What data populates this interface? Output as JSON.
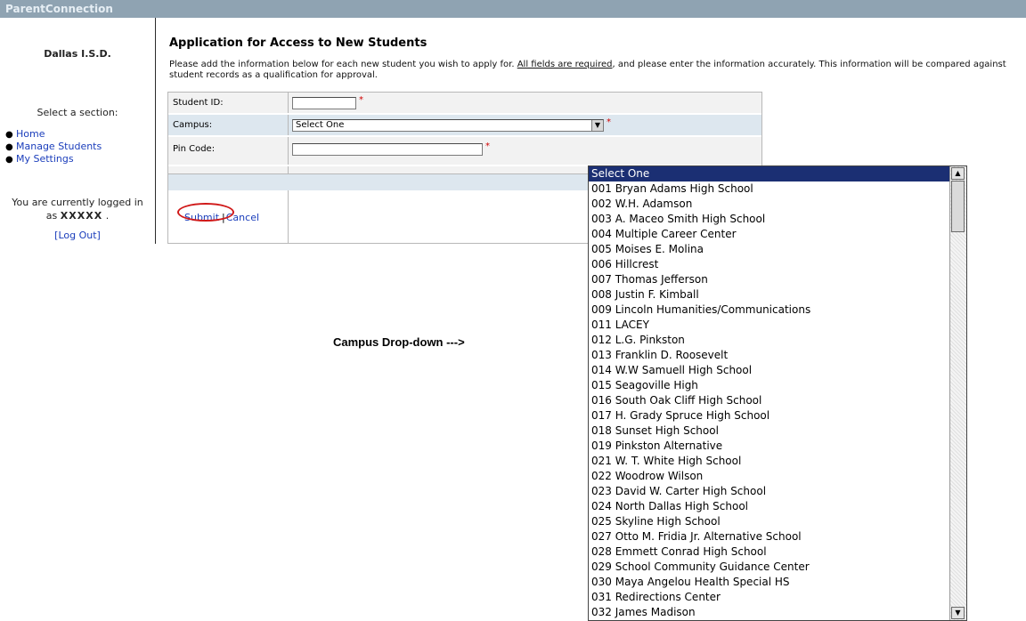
{
  "app": {
    "title": "ParentConnection"
  },
  "sidebar": {
    "district": "Dallas I.S.D.",
    "select_section": "Select a section:",
    "nav": [
      {
        "label": "Home"
      },
      {
        "label": "Manage Students"
      },
      {
        "label": "My Settings"
      }
    ],
    "logged_in_prefix": "You are currently logged in",
    "logged_in_as": "as",
    "username": "XXXXX",
    "logged_in_suffix": ".",
    "logout_label": "[Log Out]"
  },
  "main": {
    "title": "Application for Access to New Students",
    "intro_before": "Please add the information below for each new student you wish to apply for.",
    "intro_required": "All fields are required",
    "intro_after": ", and please enter the information accurately.  This information will be compared against student records as a qualification for approval.",
    "fields": {
      "student_id_label": "Student ID:",
      "campus_label": "Campus:",
      "campus_value": "Select One",
      "pin_label": "Pin Code:",
      "required_mark": "*"
    },
    "submit_label": "Submit",
    "separator": "|",
    "cancel_label": "Cancel"
  },
  "annotation": "Campus Drop-down --->",
  "campus_dropdown": {
    "options": [
      "Select One",
      "001 Bryan Adams High School",
      "002 W.H. Adamson",
      "003 A. Maceo Smith High School",
      "004 Multiple Career Center",
      "005 Moises E. Molina",
      "006 Hillcrest",
      "007 Thomas Jefferson",
      "008 Justin F. Kimball",
      "009 Lincoln Humanities/Communications",
      "011 LACEY",
      "012 L.G. Pinkston",
      "013 Franklin D. Roosevelt",
      "014 W.W Samuell High School",
      "015 Seagoville High",
      "016 South Oak Cliff High School",
      "017 H. Grady Spruce High School",
      "018 Sunset High School",
      "019 Pinkston Alternative",
      "021 W. T. White High School",
      "022 Woodrow Wilson",
      "023 David W. Carter High School",
      "024 North Dallas High School",
      "025 Skyline High School",
      "027 Otto M. Fridia Jr. Alternative School",
      "028 Emmett Conrad High School",
      "029 School Community Guidance Center",
      "030 Maya Angelou Health Special HS",
      "031 Redirections Center",
      "032 James Madison"
    ],
    "selected_index": 0
  },
  "icons": {
    "select_arrow": "chevron-down-icon",
    "scroll_up": "arrow-up-icon",
    "scroll_down": "arrow-down-icon"
  }
}
